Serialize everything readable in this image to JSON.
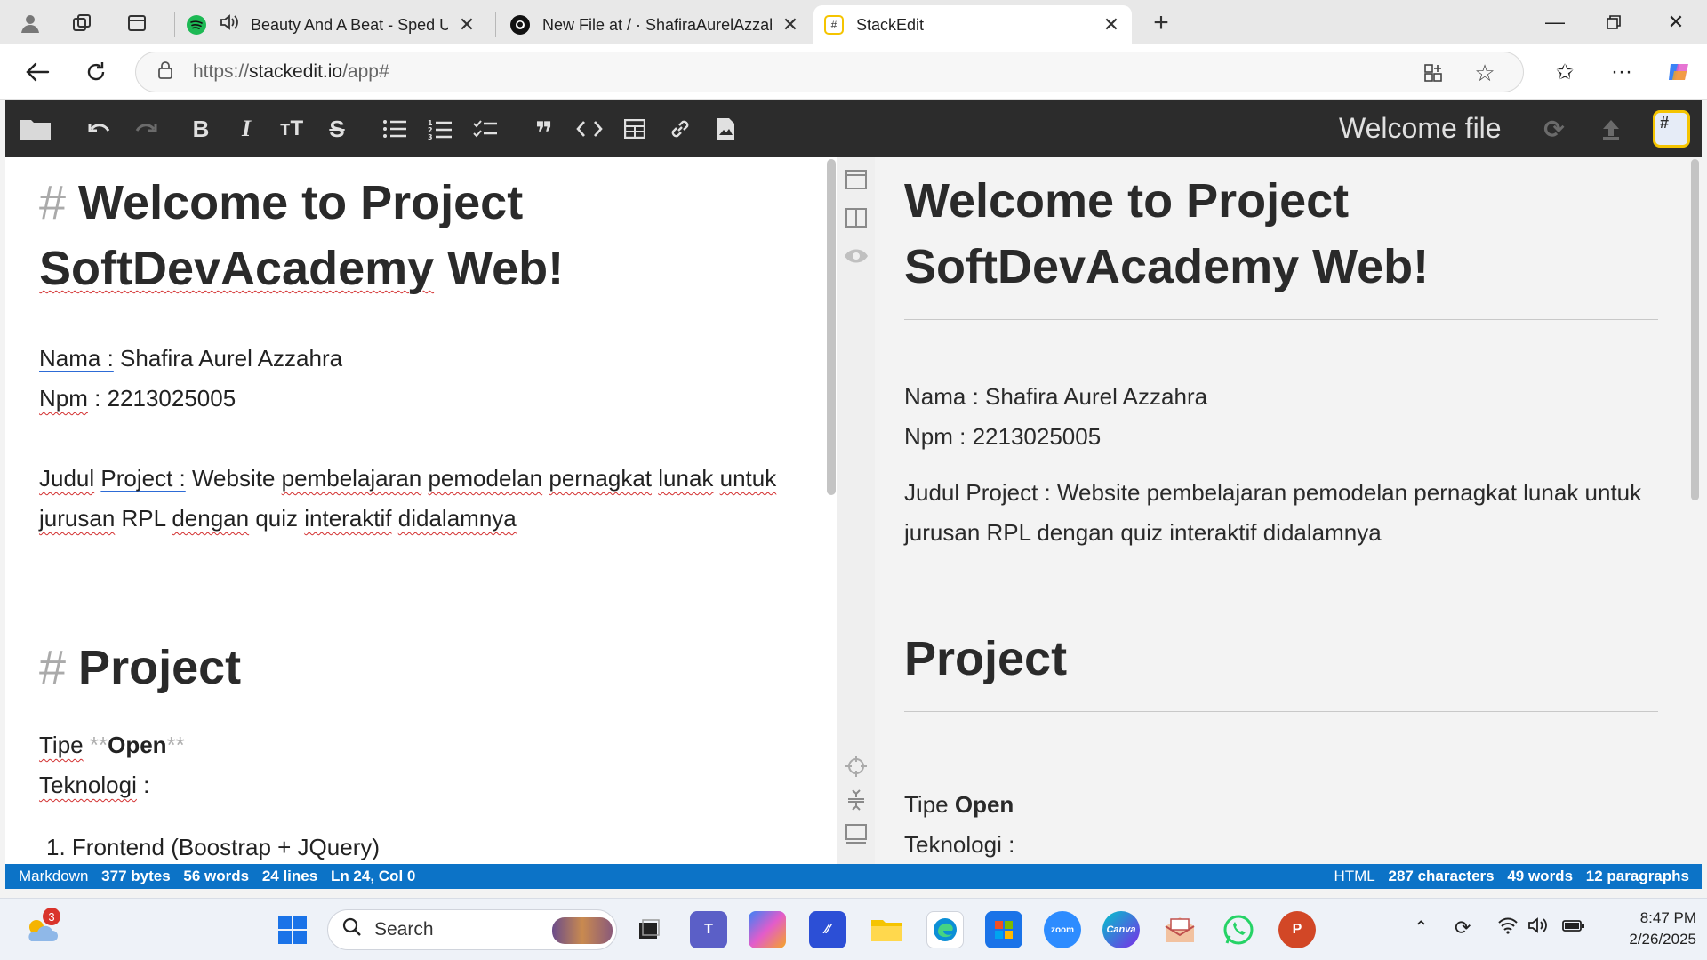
{
  "browser": {
    "tabs": [
      {
        "title": "Beauty And A Beat - Sped Up",
        "icon": "spotify-icon",
        "color": "#1db954"
      },
      {
        "title": "New File at / · ShafiraAurelAzzahra",
        "icon": "github-icon",
        "color": "#111111"
      },
      {
        "title": "StackEdit",
        "icon": "stackedit-icon",
        "color": "#f5c400",
        "active": true
      }
    ],
    "url_protocol": "https://",
    "url_host": "stackedit.io",
    "url_path": "/app#"
  },
  "toolbar": {
    "file_title": "Welcome file",
    "avatar_glyph": "#",
    "buttons": [
      "folder-icon",
      "undo-icon",
      "redo-icon",
      "bold-icon",
      "italic-icon",
      "heading-icon",
      "strikethrough-icon",
      "unordered-list-icon",
      "ordered-list-icon",
      "check-list-icon",
      "quote-icon",
      "code-icon",
      "table-icon",
      "link-icon",
      "image-icon"
    ]
  },
  "editor": {
    "h1_hash": "#",
    "title_line1": "Welcome to Project",
    "title_word1": "SoftDevAcademy",
    "title_word2": " Web!",
    "nama_label": "Nama :",
    "nama_value": " Shafira Aurel Azzahra",
    "npm_label": "Npm",
    "npm_value": " : 2213025005",
    "judul_1": "Judul",
    "judul_2": "Project :",
    "judul_3": " Website ",
    "judul_4": "pembelajaran",
    "judul_5": "pemodelan",
    "judul_6": "pernagkat",
    "judul_7": "lunak",
    "judul_8": "untuk",
    "judul_9": "jurusan",
    "judul_10": " RPL ",
    "judul_11": "dengan",
    "judul_12": " quiz ",
    "judul_13": "interaktif",
    "judul_14": "didalamnya",
    "h2_hash": "#",
    "h2": "Project",
    "tipe_label": "Tipe",
    "tipe_mark": "**",
    "tipe_value": "Open",
    "teknologi_label": "Teknologi",
    "teknologi_colon": " :",
    "list_1": "1. Frontend (Boostrap + JQuery)"
  },
  "preview": {
    "title": "Welcome to Project SoftDevAcademy Web!",
    "nama": "Nama : Shafira Aurel Azzahra",
    "npm": "Npm : 2213025005",
    "judul": "Judul Project : Website pembelajaran pemodelan pernagkat lunak untuk jurusan RPL dengan quiz interaktif didalamnya",
    "h2": "Project",
    "tipe_label": "Tipe ",
    "tipe_value": "Open",
    "teknologi": "Teknologi :"
  },
  "status": {
    "left_mode": "Markdown",
    "bytes": "377 bytes",
    "words": "56 words",
    "lines": "24 lines",
    "cursor": "Ln 24, Col 0",
    "right_mode": "HTML",
    "characters": "287 characters",
    "pv_words": "49 words",
    "paragraphs": "12 paragraphs"
  },
  "taskbar": {
    "search_label": "Search",
    "weather_badge": "3",
    "time": "8:47 PM",
    "date": "2/26/2025"
  }
}
